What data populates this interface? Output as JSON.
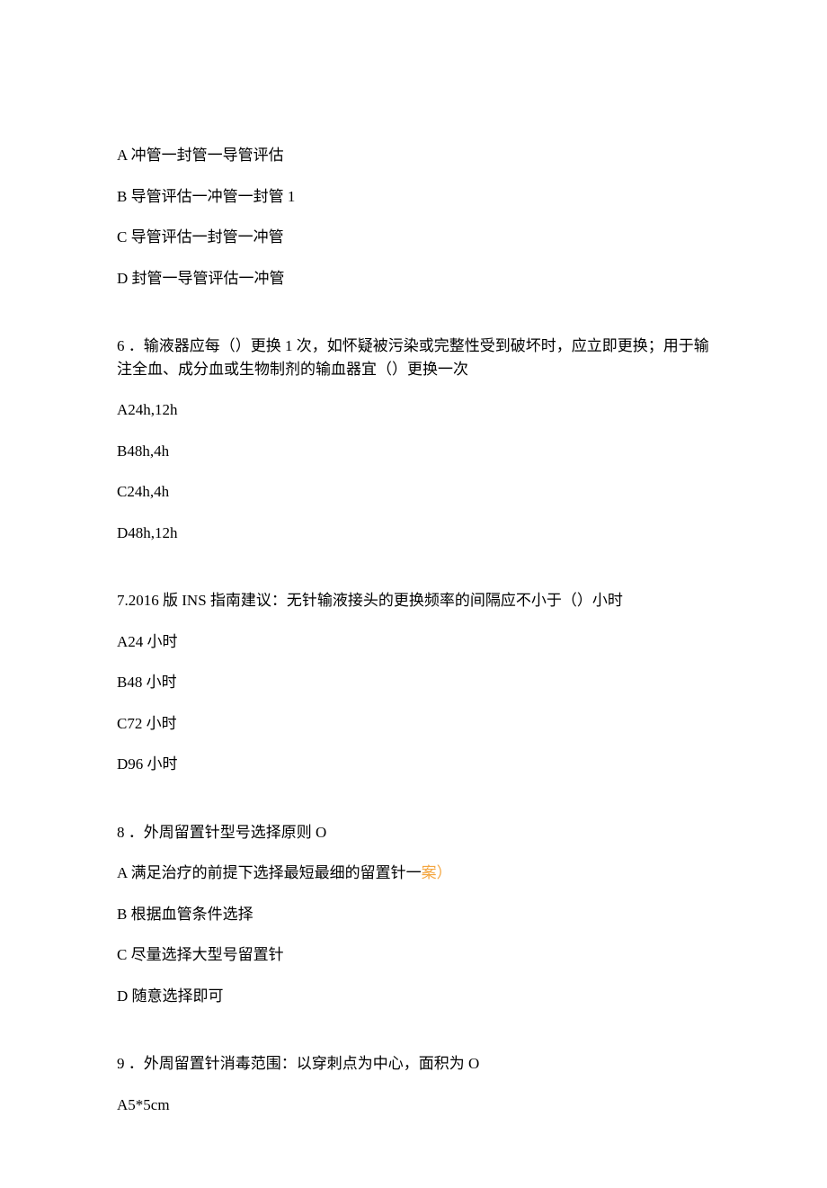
{
  "q5": {
    "a": "A 冲管一封管一导管评估",
    "b": "B 导管评估一冲管一封管 1",
    "c": "C 导管评估一封管一冲管",
    "d": "D 封管一导管评估一冲管"
  },
  "q6": {
    "stem": "6 ．输液器应每（）更换 1 次，如怀疑被污染或完整性受到破坏时，应立即更换；用于输注全血、成分血或生物制剂的输血器宜（）更换一次",
    "a": "A24h,12h",
    "b": "B48h,4h",
    "c": "C24h,4h",
    "d": "D48h,12h"
  },
  "q7": {
    "stem": "7.2016 版 INS 指南建议：无针输液接头的更换频率的间隔应不小于（）小时",
    "a": "A24 小时",
    "b": "B48 小时",
    "c": "C72 小时",
    "d": "D96 小时"
  },
  "q8": {
    "stem": "8 ．外周留置针型号选择原则 O",
    "a_pre": "A 满足治疗的前提下选择最短最细的留置针一",
    "a_hl": "案）",
    "b": "B 根据血管条件选择",
    "c": "C 尽量选择大型号留置针",
    "d": "D 随意选择即可"
  },
  "q9": {
    "stem": "9 ．外周留置针消毒范围：以穿刺点为中心，面积为 O",
    "a": "A5*5cm"
  }
}
